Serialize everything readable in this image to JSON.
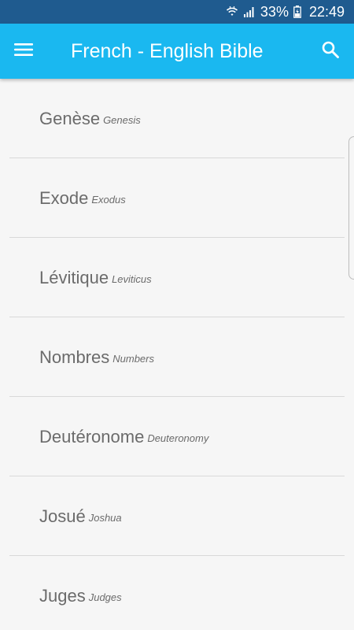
{
  "status_bar": {
    "battery": "33%",
    "time": "22:49",
    "icons": [
      "wifi-icon",
      "signal-icon",
      "battery-icon"
    ],
    "background": "#1f5b8f"
  },
  "app_bar": {
    "title": "French - English Bible",
    "menu_icon": "menu-icon",
    "search_icon": "search-icon",
    "background": "#1ab8f0"
  },
  "books": [
    {
      "fr": "Genèse",
      "en": "Genesis"
    },
    {
      "fr": "Exode",
      "en": "Exodus"
    },
    {
      "fr": "Lévitique",
      "en": "Leviticus"
    },
    {
      "fr": "Nombres",
      "en": "Numbers"
    },
    {
      "fr": "Deutéronome",
      "en": "Deuteronomy"
    },
    {
      "fr": "Josué",
      "en": "Joshua"
    },
    {
      "fr": "Juges",
      "en": "Judges"
    }
  ]
}
